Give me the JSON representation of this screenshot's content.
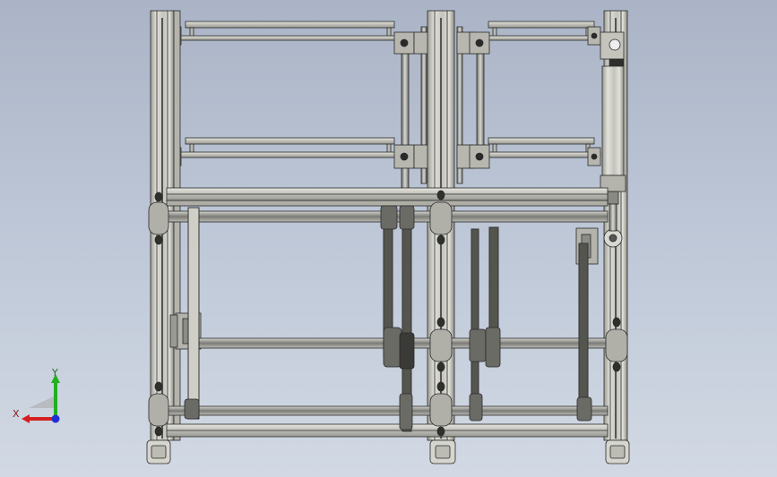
{
  "viewport": {
    "background_top": "#aab4c6",
    "background_bottom": "#d2d9e4"
  },
  "model": {
    "view": "front",
    "frame_color": "#c9c9c2",
    "frame_stroke": "#2a2a2a",
    "belt_color": "#3c3c3c",
    "shaft_color": "#8e8e8a"
  },
  "triad": {
    "x_label": "X",
    "y_label": "Y",
    "x_color": "#d42020",
    "y_color": "#20b020",
    "z_color": "#2030d0"
  }
}
